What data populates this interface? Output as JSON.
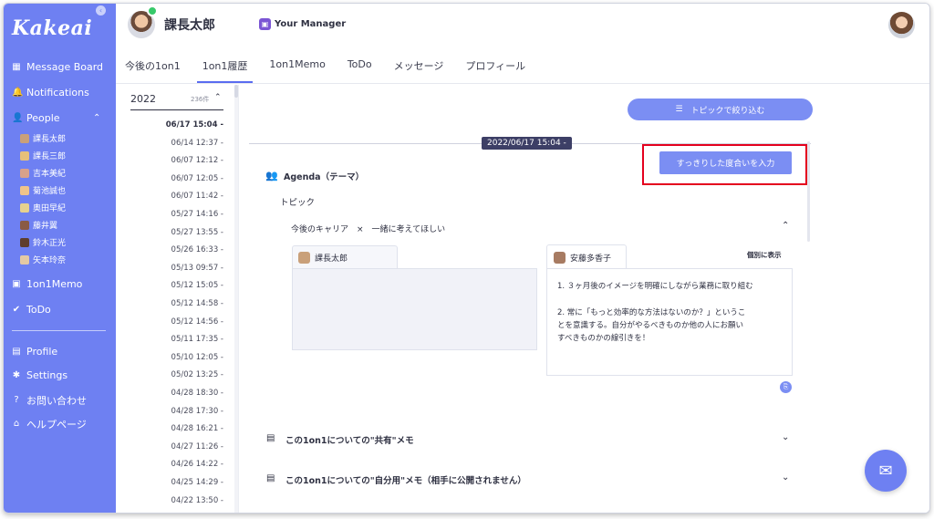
{
  "app": {
    "logo": "Kakeai",
    "collapse_icon": "‹"
  },
  "sidebar": {
    "nav": [
      {
        "label": "Message Board",
        "icon": "▦"
      },
      {
        "label": "Notifications",
        "icon": "🔔"
      },
      {
        "label": "People",
        "icon": "👤"
      }
    ],
    "people_chevron": "⌃",
    "people": [
      {
        "name": "課長太郎",
        "color": "#c9a07a"
      },
      {
        "name": "課長三郎",
        "color": "#e7c07a"
      },
      {
        "name": "吉本美紀",
        "color": "#d9a18a"
      },
      {
        "name": "菊池誠也",
        "color": "#f0c48a"
      },
      {
        "name": "奥田早紀",
        "color": "#e6d18f"
      },
      {
        "name": "藤井翼",
        "color": "#8a5a44"
      },
      {
        "name": "鈴木正光",
        "color": "#5e3d2e"
      },
      {
        "name": "矢本玲奈",
        "color": "#e4c9a4"
      }
    ],
    "nav2": [
      {
        "label": "1on1Memo",
        "icon": "▣"
      },
      {
        "label": "ToDo",
        "icon": "✔"
      }
    ],
    "nav3": [
      {
        "label": "Profile",
        "icon": "▤"
      },
      {
        "label": "Settings",
        "icon": "✱"
      },
      {
        "label": "お問い合わせ",
        "icon": "?"
      },
      {
        "label": "ヘルプページ",
        "icon": "⌂"
      }
    ]
  },
  "header": {
    "user_name": "課長太郎",
    "manager_badge_icon": "▣",
    "manager_label": "Your Manager",
    "tabs": [
      {
        "label": "今後の1on1",
        "active": false
      },
      {
        "label": "1on1履歴",
        "active": true
      },
      {
        "label": "1on1Memo",
        "active": false
      },
      {
        "label": "ToDo",
        "active": false
      },
      {
        "label": "メッセージ",
        "active": false
      },
      {
        "label": "プロフィール",
        "active": false
      }
    ]
  },
  "history": {
    "year": "2022",
    "count": "236件",
    "chevron": "⌃",
    "dates": [
      "06/17 15:04 -",
      "06/14 12:37 -",
      "06/07 12:12 -",
      "06/07 12:05 -",
      "06/07 11:42 -",
      "05/27 14:16 -",
      "05/27 13:55 -",
      "05/26 16:33 -",
      "05/13 09:57 -",
      "05/12 15:05 -",
      "05/12 14:58 -",
      "05/12 14:56 -",
      "05/11 17:35 -",
      "05/10 12:05 -",
      "05/02 13:25 -",
      "04/28 18:30 -",
      "04/28 17:30 -",
      "04/28 16:21 -",
      "04/27 11:26 -",
      "04/26 14:22 -",
      "04/25 14:29 -",
      "04/22 13:50 -"
    ],
    "selected_index": 0
  },
  "main": {
    "filter_button": "トピックで絞り込む",
    "filter_icon": "☰",
    "session_date": "2022/06/17 15:04 -",
    "mood_button": "すっきりした度合いを入力",
    "agenda_icon": "👥",
    "agenda_title": "Agenda（テーマ）",
    "topic_label": "トピック",
    "topic_text": "今後のキャリア　×　一緒に考えてほしい",
    "topic_chevron": "⌃",
    "left_card_name": "課長太郎",
    "right_card_name": "安藤多香子",
    "individual_label": "個別に表示",
    "memo_lines": [
      "1. ３ヶ月後のイメージを明確にしながら業務に取り組む",
      "",
      "2. 常に「もっと効率的な方法はないのか？」というこ",
      "とを意識する。自分がやるべきものか他の人にお願い",
      "すべきものかの線引きを！"
    ],
    "attach_icon": "⎘",
    "shared_memo_icon": "▤",
    "shared_memo": "この1on1についての\"共有\"メモ",
    "private_memo_icon": "▤",
    "private_memo": "この1on1についての\"自分用\"メモ（相手に公開されません）",
    "memo_chevron": "⌄"
  },
  "chat_icon": "✉"
}
